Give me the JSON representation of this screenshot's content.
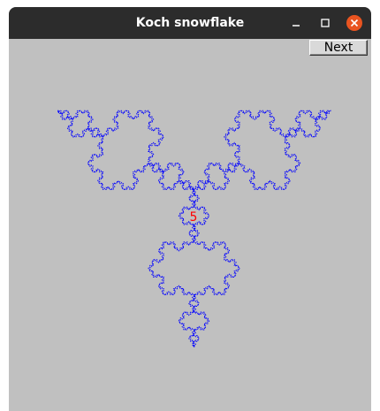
{
  "window": {
    "title": "Koch snowflake"
  },
  "toolbar": {
    "next_label": "Next"
  },
  "canvas": {
    "level": "5",
    "curve_color": "#0000ff",
    "level_color": "#ff0000",
    "background_color": "#c0c0c0"
  },
  "colors": {
    "titlebar": "#2c2c2c",
    "close_button": "#e95420"
  },
  "icons": {
    "minimize": "minimize-icon",
    "maximize": "maximize-icon",
    "close": "close-icon"
  }
}
